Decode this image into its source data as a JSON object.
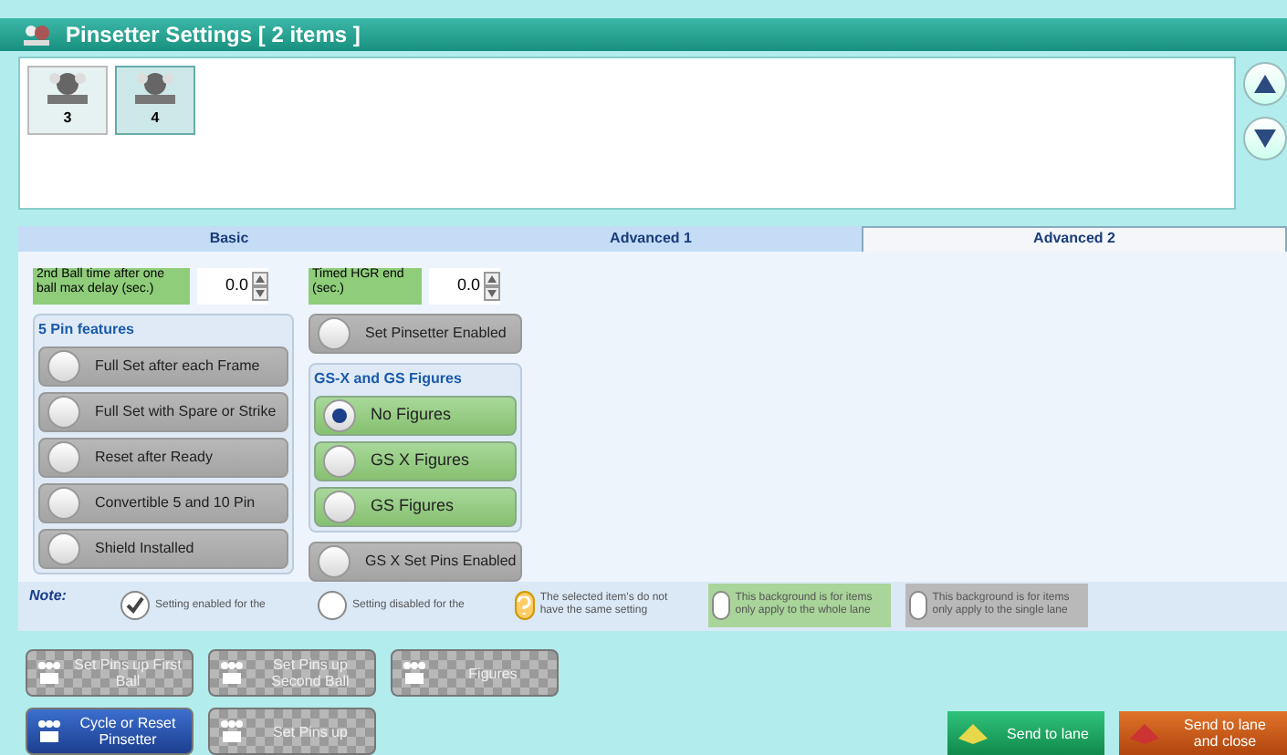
{
  "window": {
    "title": "Pinsetter Settings [ 2 items ]"
  },
  "lanes": [
    {
      "label": "3",
      "selected": false
    },
    {
      "label": "4",
      "selected": true
    }
  ],
  "tabs": [
    {
      "label": "Basic",
      "selected": false
    },
    {
      "label": "Advanced 1",
      "selected": false
    },
    {
      "label": "Advanced 2",
      "selected": true
    }
  ],
  "spinners": [
    {
      "label": "2nd Ball time after one ball max delay (sec.)",
      "value": "0.0"
    },
    {
      "label": "Timed HGR end (sec.)",
      "value": "0.0"
    }
  ],
  "five_pin": {
    "title": "5 Pin features",
    "options": [
      {
        "label": "Full Set after each Frame",
        "checked": false
      },
      {
        "label": "Full Set with Spare or Strike",
        "checked": false
      },
      {
        "label": "Reset after Ready",
        "checked": false
      },
      {
        "label": "Convertible 5 and 10 Pin",
        "checked": false
      },
      {
        "label": "Shield Installed",
        "checked": false
      }
    ]
  },
  "set_pinsetter": {
    "label": "Set Pinsetter Enabled",
    "checked": false
  },
  "figures": {
    "title": "GS-X and GS Figures",
    "options": [
      {
        "label": "No Figures",
        "selected": true
      },
      {
        "label": "GS X Figures",
        "selected": false
      },
      {
        "label": "GS Figures",
        "selected": false
      }
    ]
  },
  "gsx_set_pins": {
    "label": "GS X Set Pins Enabled",
    "checked": false
  },
  "note": {
    "label": "Note:",
    "items": [
      {
        "kind": "enabled",
        "text": "Setting enabled for the"
      },
      {
        "kind": "disabled",
        "text": "Setting disabled for the"
      },
      {
        "kind": "mixed",
        "text": "The selected item's do not have the same setting"
      },
      {
        "kind": "whole",
        "text": "This background is for items only apply to the whole lane"
      },
      {
        "kind": "single",
        "text": "This background is for items only apply to the single lane"
      }
    ]
  },
  "action_rows": [
    [
      {
        "label": "Set Pins up First Ball",
        "kind": "disabled"
      },
      {
        "label": "Set Pins up Second Ball",
        "kind": "disabled"
      },
      {
        "label": "Figures",
        "kind": "disabled"
      }
    ],
    [
      {
        "label": "Cycle or Reset Pinsetter",
        "kind": "primary"
      },
      {
        "label": "Set Pins up",
        "kind": "disabled"
      }
    ]
  ],
  "footer_buttons": [
    {
      "label": "Send to lane",
      "kind": "green"
    },
    {
      "label": "Send to lane and close",
      "kind": "orange"
    }
  ]
}
